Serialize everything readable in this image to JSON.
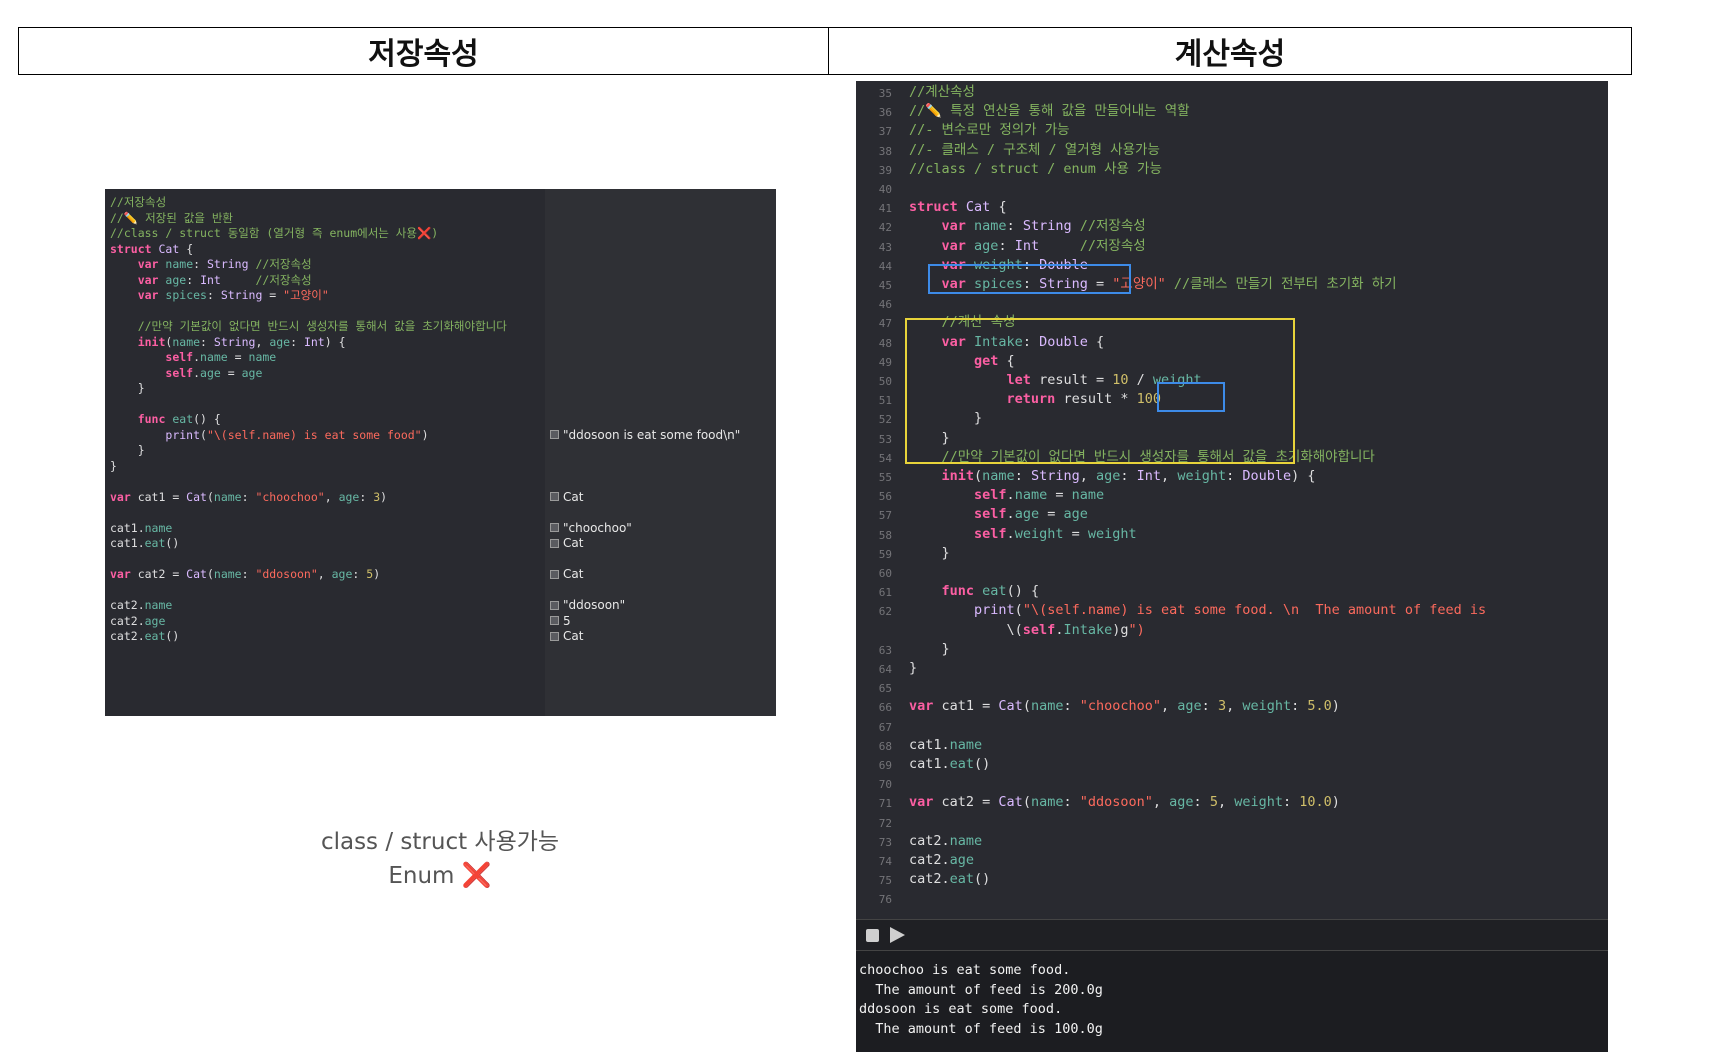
{
  "headers": {
    "left": "저장속성",
    "right": "계산속성"
  },
  "left_code": [
    "//저장속성",
    "//✏️ 저장된 값을 반환",
    "//class / struct 동일함 (열거형 즉 enum에서는 사용❌)",
    "struct Cat {",
    "    var name: String //저장속성",
    "    var age: Int     //저장속성",
    "    var spices: String = \"고양이\"",
    "",
    "    //만약 기본값이 없다면 반드시 생성자를 통해서 값을 초기화해야합니다",
    "    init(name: String, age: Int) {",
    "        self.name = name",
    "        self.age = age",
    "    }",
    "",
    "    func eat() {",
    "        print(\"\\(self.name) is eat some food\")",
    "    }",
    "}",
    "",
    "var cat1 = Cat(name: \"choochoo\", age: 3)",
    "",
    "cat1.name",
    "cat1.eat()",
    "",
    "var cat2 = Cat(name: \"ddosoon\", age: 5)",
    "",
    "cat2.name",
    "cat2.age",
    "cat2.eat()"
  ],
  "left_results": [
    {
      "line": 15,
      "text": "\"ddosoon is eat some food\\n\""
    },
    {
      "line": 19,
      "text": "Cat"
    },
    {
      "line": 21,
      "text": "\"choochoo\""
    },
    {
      "line": 22,
      "text": "Cat"
    },
    {
      "line": 24,
      "text": "Cat"
    },
    {
      "line": 26,
      "text": "\"ddosoon\""
    },
    {
      "line": 27,
      "text": "5"
    },
    {
      "line": 28,
      "text": "Cat"
    }
  ],
  "caption": {
    "line1": "class / struct 사용가능",
    "line2": "Enum",
    "line2_icon": "❌"
  },
  "right_code": [
    {
      "n": "35",
      "t": "//계산속성"
    },
    {
      "n": "36",
      "t": "//✏️ 특정 연산을 통해 값을 만들어내는 역할"
    },
    {
      "n": "37",
      "t": "//- 변수로만 정의가 가능"
    },
    {
      "n": "38",
      "t": "//- 클래스 / 구조체 / 열거형 사용가능"
    },
    {
      "n": "39",
      "t": "//class / struct / enum 사용 가능"
    },
    {
      "n": "40",
      "t": ""
    },
    {
      "n": "41",
      "t": "struct Cat {"
    },
    {
      "n": "42",
      "t": "    var name: String //저장속성"
    },
    {
      "n": "43",
      "t": "    var age: Int     //저장속성"
    },
    {
      "n": "44",
      "t": "    var weight: Double"
    },
    {
      "n": "45",
      "t": "    var spices: String = \"고양이\" //클래스 만들기 전부터 초기화 하기"
    },
    {
      "n": "46",
      "t": ""
    },
    {
      "n": "47",
      "t": "    //계산 속성"
    },
    {
      "n": "48",
      "t": "    var Intake: Double {"
    },
    {
      "n": "49",
      "t": "        get {"
    },
    {
      "n": "50",
      "t": "            let result = 10 / weight"
    },
    {
      "n": "51",
      "t": "            return result * 100"
    },
    {
      "n": "52",
      "t": "        }"
    },
    {
      "n": "53",
      "t": "    }"
    },
    {
      "n": "54",
      "t": "    //만약 기본값이 없다면 반드시 생성자를 통해서 값을 초기화해야합니다"
    },
    {
      "n": "55",
      "t": "    init(name: String, age: Int, weight: Double) {"
    },
    {
      "n": "56",
      "t": "        self.name = name"
    },
    {
      "n": "57",
      "t": "        self.age = age"
    },
    {
      "n": "58",
      "t": "        self.weight = weight"
    },
    {
      "n": "59",
      "t": "    }"
    },
    {
      "n": "60",
      "t": ""
    },
    {
      "n": "61",
      "t": "    func eat() {"
    },
    {
      "n": "62",
      "t": "        print(\"\\(self.name) is eat some food. \\n  The amount of feed is"
    },
    {
      "n": "",
      "t": "            \\(self.Intake)g\")"
    },
    {
      "n": "63",
      "t": "    }"
    },
    {
      "n": "64",
      "t": "}"
    },
    {
      "n": "65",
      "t": ""
    },
    {
      "n": "66",
      "t": "var cat1 = Cat(name: \"choochoo\", age: 3, weight: 5.0)"
    },
    {
      "n": "67",
      "t": ""
    },
    {
      "n": "68",
      "t": "cat1.name"
    },
    {
      "n": "69",
      "t": "cat1.eat()"
    },
    {
      "n": "70",
      "t": ""
    },
    {
      "n": "71",
      "t": "var cat2 = Cat(name: \"ddosoon\", age: 5, weight: 10.0)"
    },
    {
      "n": "72",
      "t": ""
    },
    {
      "n": "73",
      "t": "cat2.name"
    },
    {
      "n": "74",
      "t": "cat2.age"
    },
    {
      "n": "75",
      "t": "cat2.eat()"
    },
    {
      "n": "76",
      "t": ""
    }
  ],
  "console": [
    "choochoo is eat some food.",
    "  The amount of feed is 200.0g",
    "ddosoon is eat some food.",
    "  The amount of feed is 100.0g"
  ],
  "colors": {
    "highlight_blue": "#3d8be8",
    "highlight_yellow": "#e7d33a",
    "editor_bg": "#292a30"
  },
  "icons": {
    "console_stop": "stop-icon",
    "console_run": "play-icon"
  }
}
